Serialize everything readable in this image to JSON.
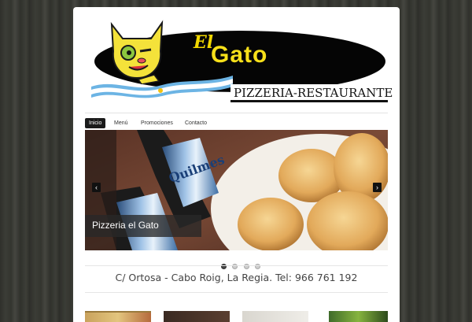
{
  "brand": {
    "prefix": "El",
    "name": "Gato",
    "tagline": "PIZZERIA-RESTAURANTE"
  },
  "nav": {
    "items": [
      {
        "label": "Inicio",
        "active": true
      },
      {
        "label": "Menú",
        "active": false
      },
      {
        "label": "Promociones",
        "active": false
      },
      {
        "label": "Contacto",
        "active": false
      }
    ]
  },
  "slider": {
    "caption": "Pizzeria el Gato",
    "prev_icon": "chevron-left-icon",
    "next_icon": "chevron-right-icon",
    "bottle_label": "Quilmes",
    "slide_count": 4,
    "current_slide": 1
  },
  "address": "C/ Ortosa - Cabo Roig, La Regia. Tel: 966 761 192",
  "colors": {
    "accent_yellow": "#f7e01a",
    "logo_black": "#050505",
    "flag_blue": "#6cb4e4",
    "nav_active_bg": "#1a1a1a"
  }
}
